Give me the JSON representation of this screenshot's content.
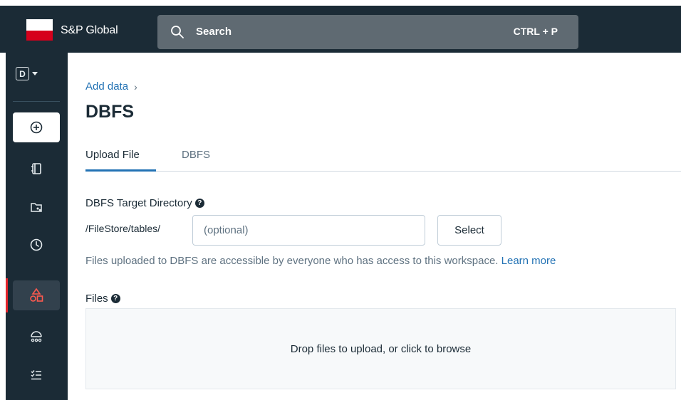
{
  "header": {
    "brand": "S&P Global",
    "search": {
      "label": "Search",
      "shortcut": "CTRL + P"
    }
  },
  "sidebar": {
    "workspace_letter": "D",
    "items": [
      {
        "icon": "plus-circle-icon"
      },
      {
        "icon": "notebook-icon"
      },
      {
        "icon": "workspace-icon"
      },
      {
        "icon": "clock-icon"
      },
      {
        "icon": "data-icon",
        "active": true
      },
      {
        "icon": "compute-icon"
      },
      {
        "icon": "workflows-icon"
      }
    ]
  },
  "breadcrumb": {
    "parent": "Add data",
    "separator": "›"
  },
  "page": {
    "title": "DBFS"
  },
  "tabs": [
    {
      "label": "Upload File",
      "selected": true
    },
    {
      "label": "DBFS",
      "selected": false
    }
  ],
  "target_dir": {
    "label": "DBFS Target Directory",
    "prefix": "/FileStore/tables/",
    "placeholder": "(optional)",
    "value": "",
    "select_button": "Select"
  },
  "info": {
    "text": "Files uploaded to DBFS are accessible by everyone who has access to this workspace.",
    "link": "Learn more"
  },
  "files": {
    "label": "Files",
    "dropzone_text": "Drop files to upload, or click to browse"
  },
  "colors": {
    "nav_bg": "#1b2b36",
    "accent_blue": "#2272b4",
    "accent_red": "#e3242b",
    "search_bg": "#5f6a72"
  }
}
